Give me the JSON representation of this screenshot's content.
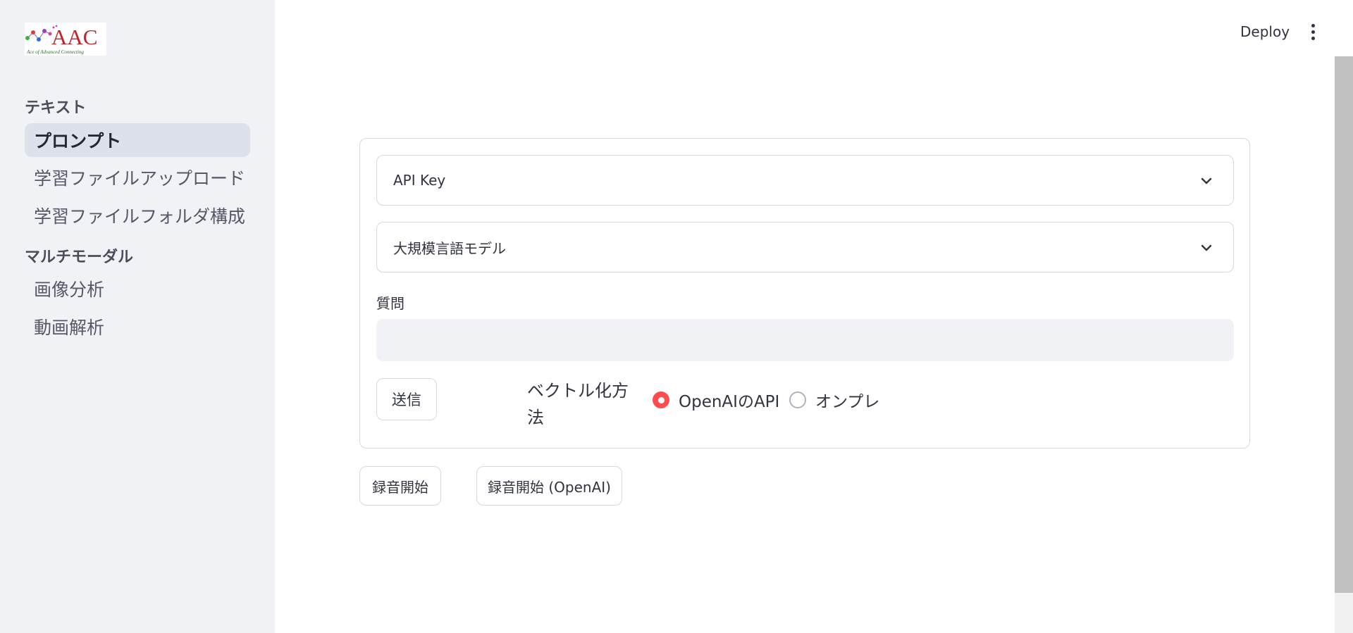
{
  "header": {
    "deploy_label": "Deploy"
  },
  "sidebar": {
    "logo_text": "AAC",
    "logo_tagline": "Ace of Advanced Connecting",
    "sections": [
      {
        "title": "テキスト",
        "items": [
          "プロンプト",
          "学習ファイルアップロード",
          "学習ファイルフォルダ構成"
        ]
      },
      {
        "title": "マルチモーダル",
        "items": [
          "画像分析",
          "動画解析"
        ]
      }
    ],
    "active_item": "プロンプト"
  },
  "form": {
    "api_key_label": "API Key",
    "llm_label": "大規模言語モデル",
    "question_label": "質問",
    "question_value": "",
    "submit_label": "送信",
    "vectorize_label": "ベクトル化方法",
    "radio_options": [
      "OpenAIのAPI",
      "オンプレ"
    ],
    "radio_selected": "OpenAIのAPI"
  },
  "buttons": {
    "record_start": "録音開始",
    "record_start_openai": "録音開始 (OpenAI)"
  },
  "colors": {
    "accent": "#ff4b4b",
    "sidebar_bg": "#f0f2f6",
    "active_item_bg": "#dde1ea"
  }
}
